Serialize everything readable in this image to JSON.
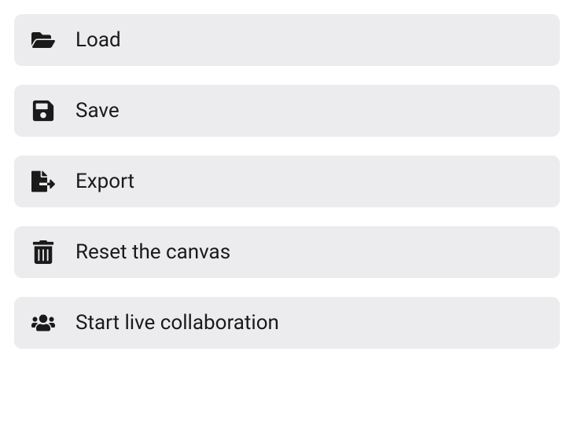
{
  "menu": {
    "items": [
      {
        "label": "Load",
        "icon": "folder-open-icon"
      },
      {
        "label": "Save",
        "icon": "save-icon"
      },
      {
        "label": "Export",
        "icon": "export-icon"
      },
      {
        "label": "Reset the canvas",
        "icon": "trash-icon"
      },
      {
        "label": "Start live collaboration",
        "icon": "users-icon"
      }
    ]
  }
}
